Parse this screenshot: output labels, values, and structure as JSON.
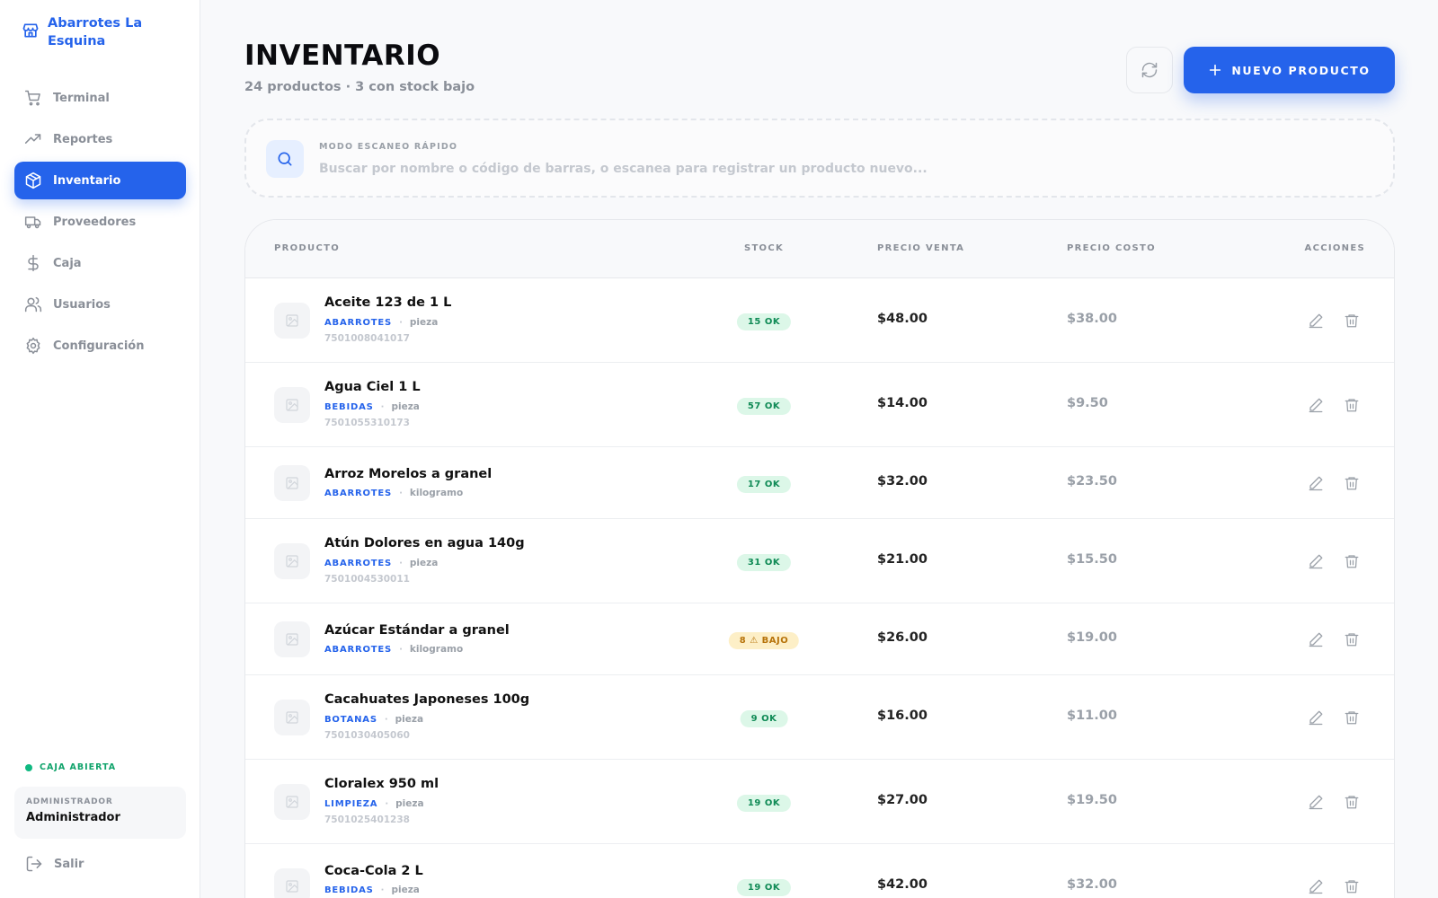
{
  "brand": {
    "name": "Abarrotes La Esquina"
  },
  "sidebar": {
    "items": [
      {
        "label": "Terminal",
        "icon": "cart-icon",
        "active": false
      },
      {
        "label": "Reportes",
        "icon": "trending-up-icon",
        "active": false
      },
      {
        "label": "Inventario",
        "icon": "box-icon",
        "active": true
      },
      {
        "label": "Proveedores",
        "icon": "truck-icon",
        "active": false
      },
      {
        "label": "Caja",
        "icon": "dollar-icon",
        "active": false
      },
      {
        "label": "Usuarios",
        "icon": "users-icon",
        "active": false
      },
      {
        "label": "Configuración",
        "icon": "gear-icon",
        "active": false
      }
    ],
    "status": "CAJA ABIERTA",
    "user": {
      "role": "ADMINISTRADOR",
      "name": "Administrador"
    },
    "logout_label": "Salir"
  },
  "header": {
    "title": "INVENTARIO",
    "subtitle": "24 productos · 3 con stock bajo",
    "new_button_label": "NUEVO PRODUCTO"
  },
  "search": {
    "label": "MODO ESCANEO RÁPIDO",
    "placeholder": "Buscar por nombre o código de barras, o escanea para registrar un producto nuevo...",
    "value": ""
  },
  "table": {
    "columns": [
      "PRODUCTO",
      "STOCK",
      "PRECIO VENTA",
      "PRECIO COSTO",
      "ACCIONES"
    ],
    "rows": [
      {
        "name": "Aceite 123 de 1 L",
        "category": "ABARROTES",
        "unit": "pieza",
        "barcode": "7501008041017",
        "stock": "15 OK",
        "status": "ok",
        "price": "$48.00",
        "cost": "$38.00"
      },
      {
        "name": "Agua Ciel 1 L",
        "category": "BEBIDAS",
        "unit": "pieza",
        "barcode": "7501055310173",
        "stock": "57 OK",
        "status": "ok",
        "price": "$14.00",
        "cost": "$9.50"
      },
      {
        "name": "Arroz Morelos a granel",
        "category": "ABARROTES",
        "unit": "kilogramo",
        "barcode": "",
        "stock": "17 OK",
        "status": "ok",
        "price": "$32.00",
        "cost": "$23.50"
      },
      {
        "name": "Atún Dolores en agua 140g",
        "category": "ABARROTES",
        "unit": "pieza",
        "barcode": "7501004530011",
        "stock": "31 OK",
        "status": "ok",
        "price": "$21.00",
        "cost": "$15.50"
      },
      {
        "name": "Azúcar Estándar a granel",
        "category": "ABARROTES",
        "unit": "kilogramo",
        "barcode": "",
        "stock": "8 ⚠ BAJO",
        "status": "low",
        "price": "$26.00",
        "cost": "$19.00"
      },
      {
        "name": "Cacahuates Japoneses 100g",
        "category": "BOTANAS",
        "unit": "pieza",
        "barcode": "7501030405060",
        "stock": "9 OK",
        "status": "ok",
        "price": "$16.00",
        "cost": "$11.00"
      },
      {
        "name": "Cloralex 950 ml",
        "category": "LIMPIEZA",
        "unit": "pieza",
        "barcode": "7501025401238",
        "stock": "19 OK",
        "status": "ok",
        "price": "$27.00",
        "cost": "$19.50"
      },
      {
        "name": "Coca-Cola 2 L",
        "category": "BEBIDAS",
        "unit": "pieza",
        "barcode": "",
        "stock": "19 OK",
        "status": "ok",
        "price": "$42.00",
        "cost": "$32.00"
      }
    ]
  },
  "colors": {
    "accent": "#2563eb",
    "ok": "#0f8a55",
    "low": "#b7730a"
  }
}
